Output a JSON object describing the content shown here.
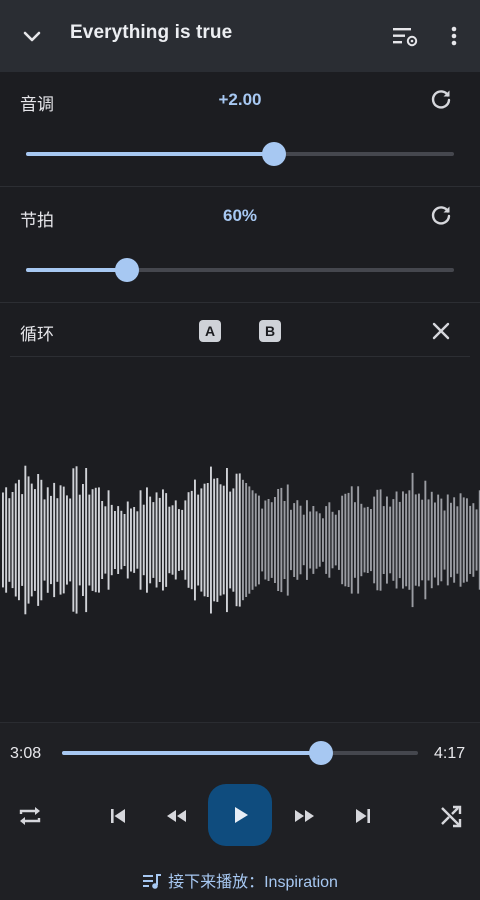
{
  "header": {
    "title": "Everything is true",
    "icons": [
      "chevron-down-icon",
      "equalizer-settings-icon",
      "more-vert-icon"
    ]
  },
  "pitch": {
    "label": "音调",
    "value": "+2.00",
    "slider_fraction": 0.58
  },
  "tempo": {
    "label": "节拍",
    "value": "60%",
    "slider_fraction": 0.235
  },
  "loop": {
    "label": "循环",
    "a_label": "A",
    "b_label": "B"
  },
  "player": {
    "elapsed": "3:08",
    "duration": "4:17",
    "progress_fraction": 0.727,
    "upnext_prefix": "接下来播放：",
    "upnext_title": "Inspiration"
  },
  "colors": {
    "accent": "#a7c8f2",
    "background": "#1c1d21",
    "header": "#2a2d33",
    "play_button": "#0f4c7e",
    "wave_played": "#d0d2d7",
    "wave_unplayed": "#9a9ca2"
  }
}
